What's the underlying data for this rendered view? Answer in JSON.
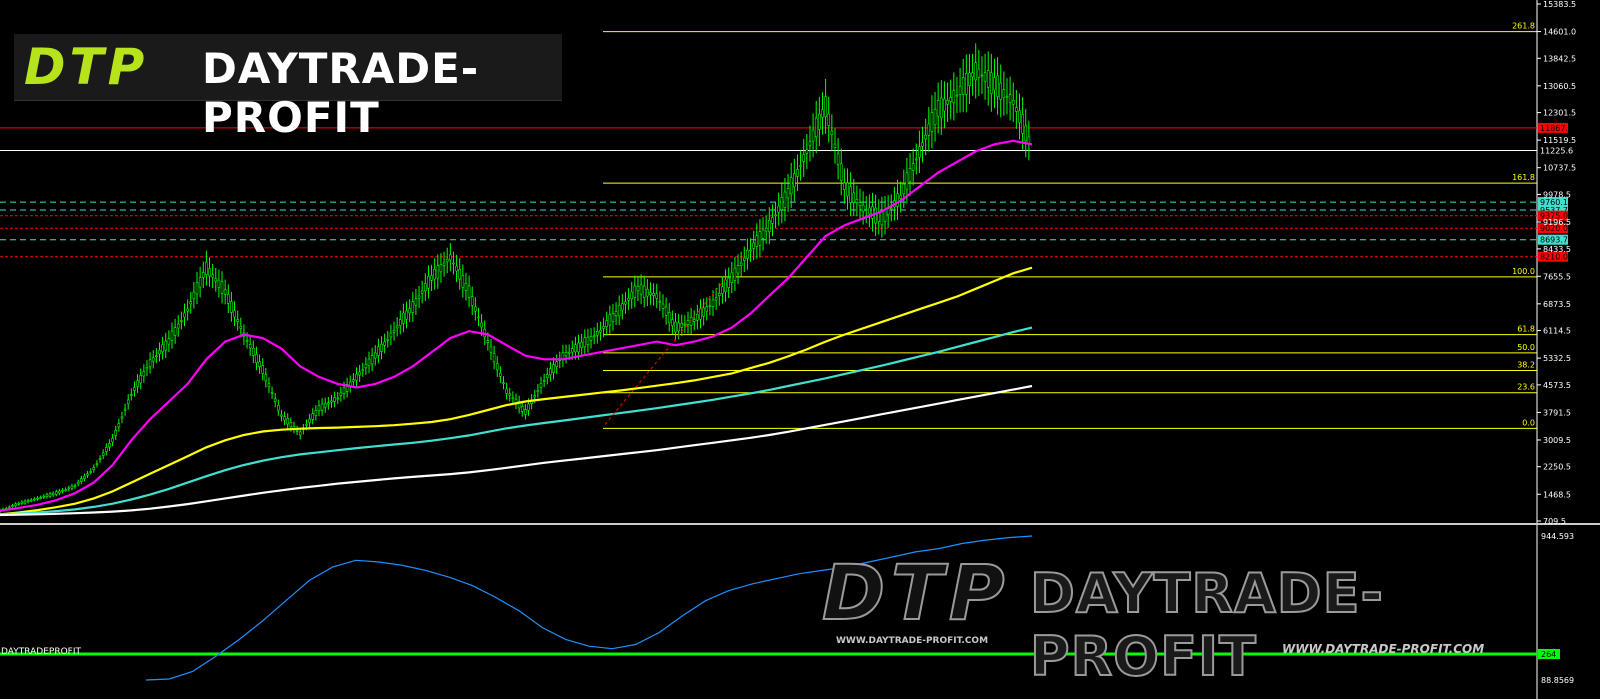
{
  "logo": {
    "mark": "DTP",
    "text": "DAYTRADE-PROFIT"
  },
  "watermark": {
    "mark": "DTP",
    "text": "DAYTRADE-PROFIT",
    "url_small": "WWW.DAYTRADE-PROFIT.COM",
    "url_large": "WWW.DAYTRADE-PROFIT.COM"
  },
  "indicator_label": "DAYTRADEPROFIT",
  "colors": {
    "background": "#000000",
    "candles": "#00ff00",
    "ma_fast": "#ff00ff",
    "ma_mid": "#ffff00",
    "ma_slow": "#40e0d0",
    "ma_long": "#ffffff",
    "fib": "#ffff00",
    "resistance": "#ff0000",
    "support_dashed": "#40e0d0",
    "indicator": "#1e90ff",
    "indicator_base": "#00ff00"
  },
  "chart_data": [
    {
      "type": "line",
      "title": "",
      "y_axis_ticks": [
        "15383.5",
        "14601.0",
        "13842.5",
        "13060.5",
        "12301.5",
        "11519.5",
        "10737.5",
        "9978.5",
        "9196.5",
        "8433.5",
        "7655.5",
        "6873.5",
        "6114.5",
        "5332.5",
        "4573.5",
        "3791.5",
        "3009.5",
        "2250.5",
        "1468.5",
        "709.5"
      ],
      "ylim": [
        709.5,
        15383.5
      ],
      "price_labels": [
        {
          "text": "11867.0",
          "value": 11867,
          "color": "#ff0000"
        },
        {
          "text": "11225.6",
          "value": 11225.6,
          "color": "#ffffff"
        },
        {
          "text": "9760.1",
          "value": 9760.1,
          "color": "#40e0d0"
        },
        {
          "text": "9537.7",
          "value": 9537.7,
          "color": "#40e0d0"
        },
        {
          "text": "9375.0",
          "value": 9375,
          "color": "#ff0000"
        },
        {
          "text": "9020.0",
          "value": 9020,
          "color": "#ff0000"
        },
        {
          "text": "8693.7",
          "value": 8693.7,
          "color": "#40e0d0"
        },
        {
          "text": "8210.0",
          "value": 8210,
          "color": "#ff0000"
        }
      ],
      "fibonacci_levels": [
        {
          "label": "261.8",
          "value": 14600
        },
        {
          "label": "161.8",
          "value": 10300
        },
        {
          "label": "100.0",
          "value": 7640
        },
        {
          "label": "61.8",
          "value": 6000
        },
        {
          "label": "50.0",
          "value": 5480
        },
        {
          "label": "38.2",
          "value": 4980
        },
        {
          "label": "23.6",
          "value": 4350
        },
        {
          "label": "0.0",
          "value": 3340
        }
      ],
      "series": [
        {
          "type": "candles",
          "values": [
            1000,
            1200,
            1350,
            1500,
            1700,
            2200,
            3000,
            4300,
            5200,
            5800,
            6700,
            7900,
            7200,
            6000,
            5000,
            3700,
            3200,
            3900,
            4200,
            4800,
            5400,
            6100,
            6800,
            7600,
            8200,
            7200,
            5800,
            4400,
            3800,
            4700,
            5400,
            5700,
            6100,
            6700,
            7300,
            7100,
            6200,
            6400,
            6900,
            7600,
            8400,
            9100,
            10000,
            11200,
            12500,
            10200,
            9600,
            9300,
            9900,
            11200,
            12400,
            12800,
            13500,
            13100,
            12600,
            11300
          ]
        },
        {
          "values": [
            1000,
            1080,
            1170,
            1300,
            1500,
            1800,
            2300,
            3000,
            3600,
            4100,
            4600,
            5300,
            5800,
            6000,
            5900,
            5600,
            5100,
            4800,
            4600,
            4500,
            4600,
            4800,
            5100,
            5500,
            5900,
            6100,
            6000,
            5700,
            5400,
            5300,
            5300,
            5400,
            5500,
            5600,
            5700,
            5800,
            5700,
            5800,
            5950,
            6200,
            6600,
            7100,
            7600,
            8200,
            8800,
            9100,
            9300,
            9500,
            9800,
            10200,
            10600,
            10900,
            11200,
            11400,
            11500,
            11400
          ]
        },
        {
          "values": [
            900,
            950,
            1020,
            1100,
            1200,
            1350,
            1550,
            1800,
            2050,
            2300,
            2550,
            2800,
            3000,
            3150,
            3250,
            3300,
            3330,
            3350,
            3360,
            3380,
            3400,
            3430,
            3470,
            3520,
            3600,
            3720,
            3860,
            4000,
            4100,
            4170,
            4230,
            4290,
            4350,
            4410,
            4480,
            4550,
            4620,
            4700,
            4800,
            4900,
            5050,
            5200,
            5380,
            5580,
            5800,
            6000,
            6180,
            6360,
            6540,
            6720,
            6900,
            7080,
            7300,
            7520,
            7740,
            7900
          ]
        },
        {
          "values": [
            900,
            920,
            950,
            990,
            1040,
            1110,
            1200,
            1320,
            1460,
            1620,
            1800,
            1980,
            2150,
            2300,
            2420,
            2520,
            2600,
            2660,
            2720,
            2780,
            2830,
            2880,
            2930,
            2990,
            3060,
            3140,
            3240,
            3340,
            3420,
            3490,
            3560,
            3630,
            3700,
            3770,
            3840,
            3910,
            3990,
            4070,
            4150,
            4240,
            4330,
            4430,
            4540,
            4650,
            4760,
            4880,
            5000,
            5120,
            5250,
            5380,
            5510,
            5650,
            5790,
            5930,
            6070,
            6200
          ]
        },
        {
          "values": [
            880,
            890,
            900,
            915,
            930,
            950,
            975,
            1010,
            1060,
            1120,
            1190,
            1270,
            1350,
            1430,
            1510,
            1580,
            1650,
            1710,
            1770,
            1820,
            1870,
            1920,
            1960,
            2000,
            2040,
            2090,
            2150,
            2220,
            2290,
            2360,
            2420,
            2480,
            2540,
            2600,
            2660,
            2720,
            2790,
            2860,
            2930,
            3000,
            3070,
            3150,
            3240,
            3340,
            3440,
            3540,
            3640,
            3740,
            3840,
            3940,
            4040,
            4140,
            4240,
            4340,
            4440,
            4540
          ]
        }
      ]
    },
    {
      "type": "line",
      "title": "",
      "y_axis_ticks": [
        "944.593",
        "88.8569"
      ],
      "ylim": [
        88.8569,
        944.593
      ],
      "level_label": "264",
      "series": [
        {
          "values": [
            88.9,
            95,
            140,
            230,
            330,
            440,
            560,
            680,
            760,
            800,
            790,
            770,
            740,
            700,
            650,
            580,
            500,
            400,
            330,
            290,
            275,
            300,
            370,
            470,
            560,
            620,
            660,
            690,
            720,
            740,
            760,
            790,
            820,
            850,
            870,
            900,
            920,
            935,
            944.6
          ]
        }
      ]
    }
  ]
}
